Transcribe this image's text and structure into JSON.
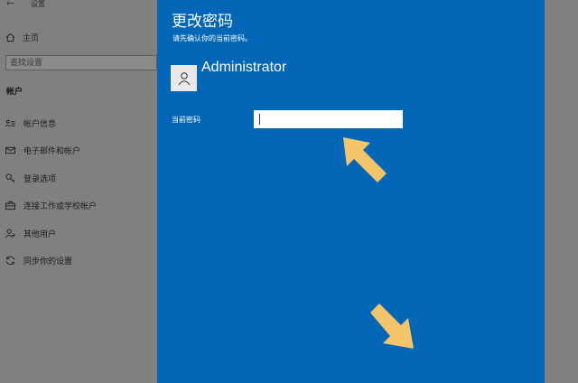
{
  "settings": {
    "app_title": "设置",
    "home_label": "主页",
    "search_placeholder": "查找设置",
    "section_title": "帐户",
    "nav_items": [
      {
        "label": "帐户信息",
        "icon": "person-card-icon"
      },
      {
        "label": "电子邮件和帐户",
        "icon": "mail-icon"
      },
      {
        "label": "登录选项",
        "icon": "key-icon"
      },
      {
        "label": "连接工作或学校帐户",
        "icon": "briefcase-icon"
      },
      {
        "label": "其他用户",
        "icon": "person-add-icon"
      },
      {
        "label": "同步你的设置",
        "icon": "sync-icon"
      }
    ]
  },
  "dialog": {
    "title": "更改密码",
    "subtitle": "请先确认你的当前密码。",
    "username": "Administrator",
    "password_label": "当前密码",
    "password_value": ""
  },
  "colors": {
    "dialog_blue": "#0366b6",
    "arrow_yellow": "#f5c56a",
    "dim_background": "#808080"
  }
}
